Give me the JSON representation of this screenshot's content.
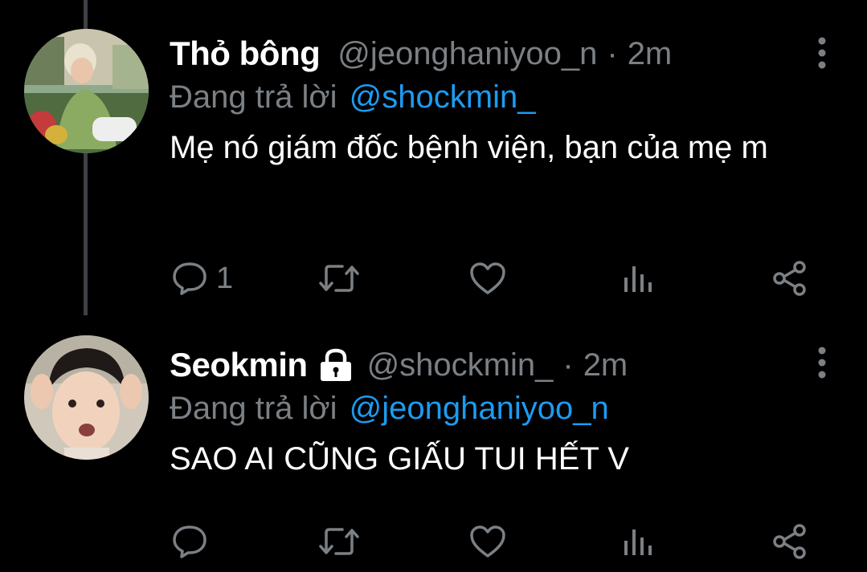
{
  "tweets": [
    {
      "display_name": "Thỏ bông",
      "handle": "@jeonghaniyoo_n",
      "separator": "·",
      "time": "2m",
      "reply_prefix": "Đang trả lời",
      "reply_to": "@shockmin_",
      "text": "Mẹ nó giám đốc bệnh viện, bạn của mẹ m",
      "reply_count": "1",
      "protected": false
    },
    {
      "display_name": "Seokmin",
      "handle": "@shockmin_",
      "separator": "·",
      "time": "2m",
      "reply_prefix": "Đang trả lời",
      "reply_to": "@jeonghaniyoo_n",
      "text": "SAO AI CŨNG GIẤU TUI HẾT V",
      "reply_count": "",
      "protected": true
    }
  ],
  "icons": {
    "reply": "speech-bubble-icon",
    "retweet": "retweet-arrows-icon",
    "like": "heart-icon",
    "views": "bar-chart-icon",
    "share": "share-nodes-icon",
    "more": "vertical-dots-icon",
    "lock": "lock-icon"
  },
  "colors": {
    "background": "#000000",
    "primary_text": "#ffffff",
    "secondary_text": "#7b8085",
    "link": "#1d9bf0",
    "thread_line": "#3d4045"
  }
}
